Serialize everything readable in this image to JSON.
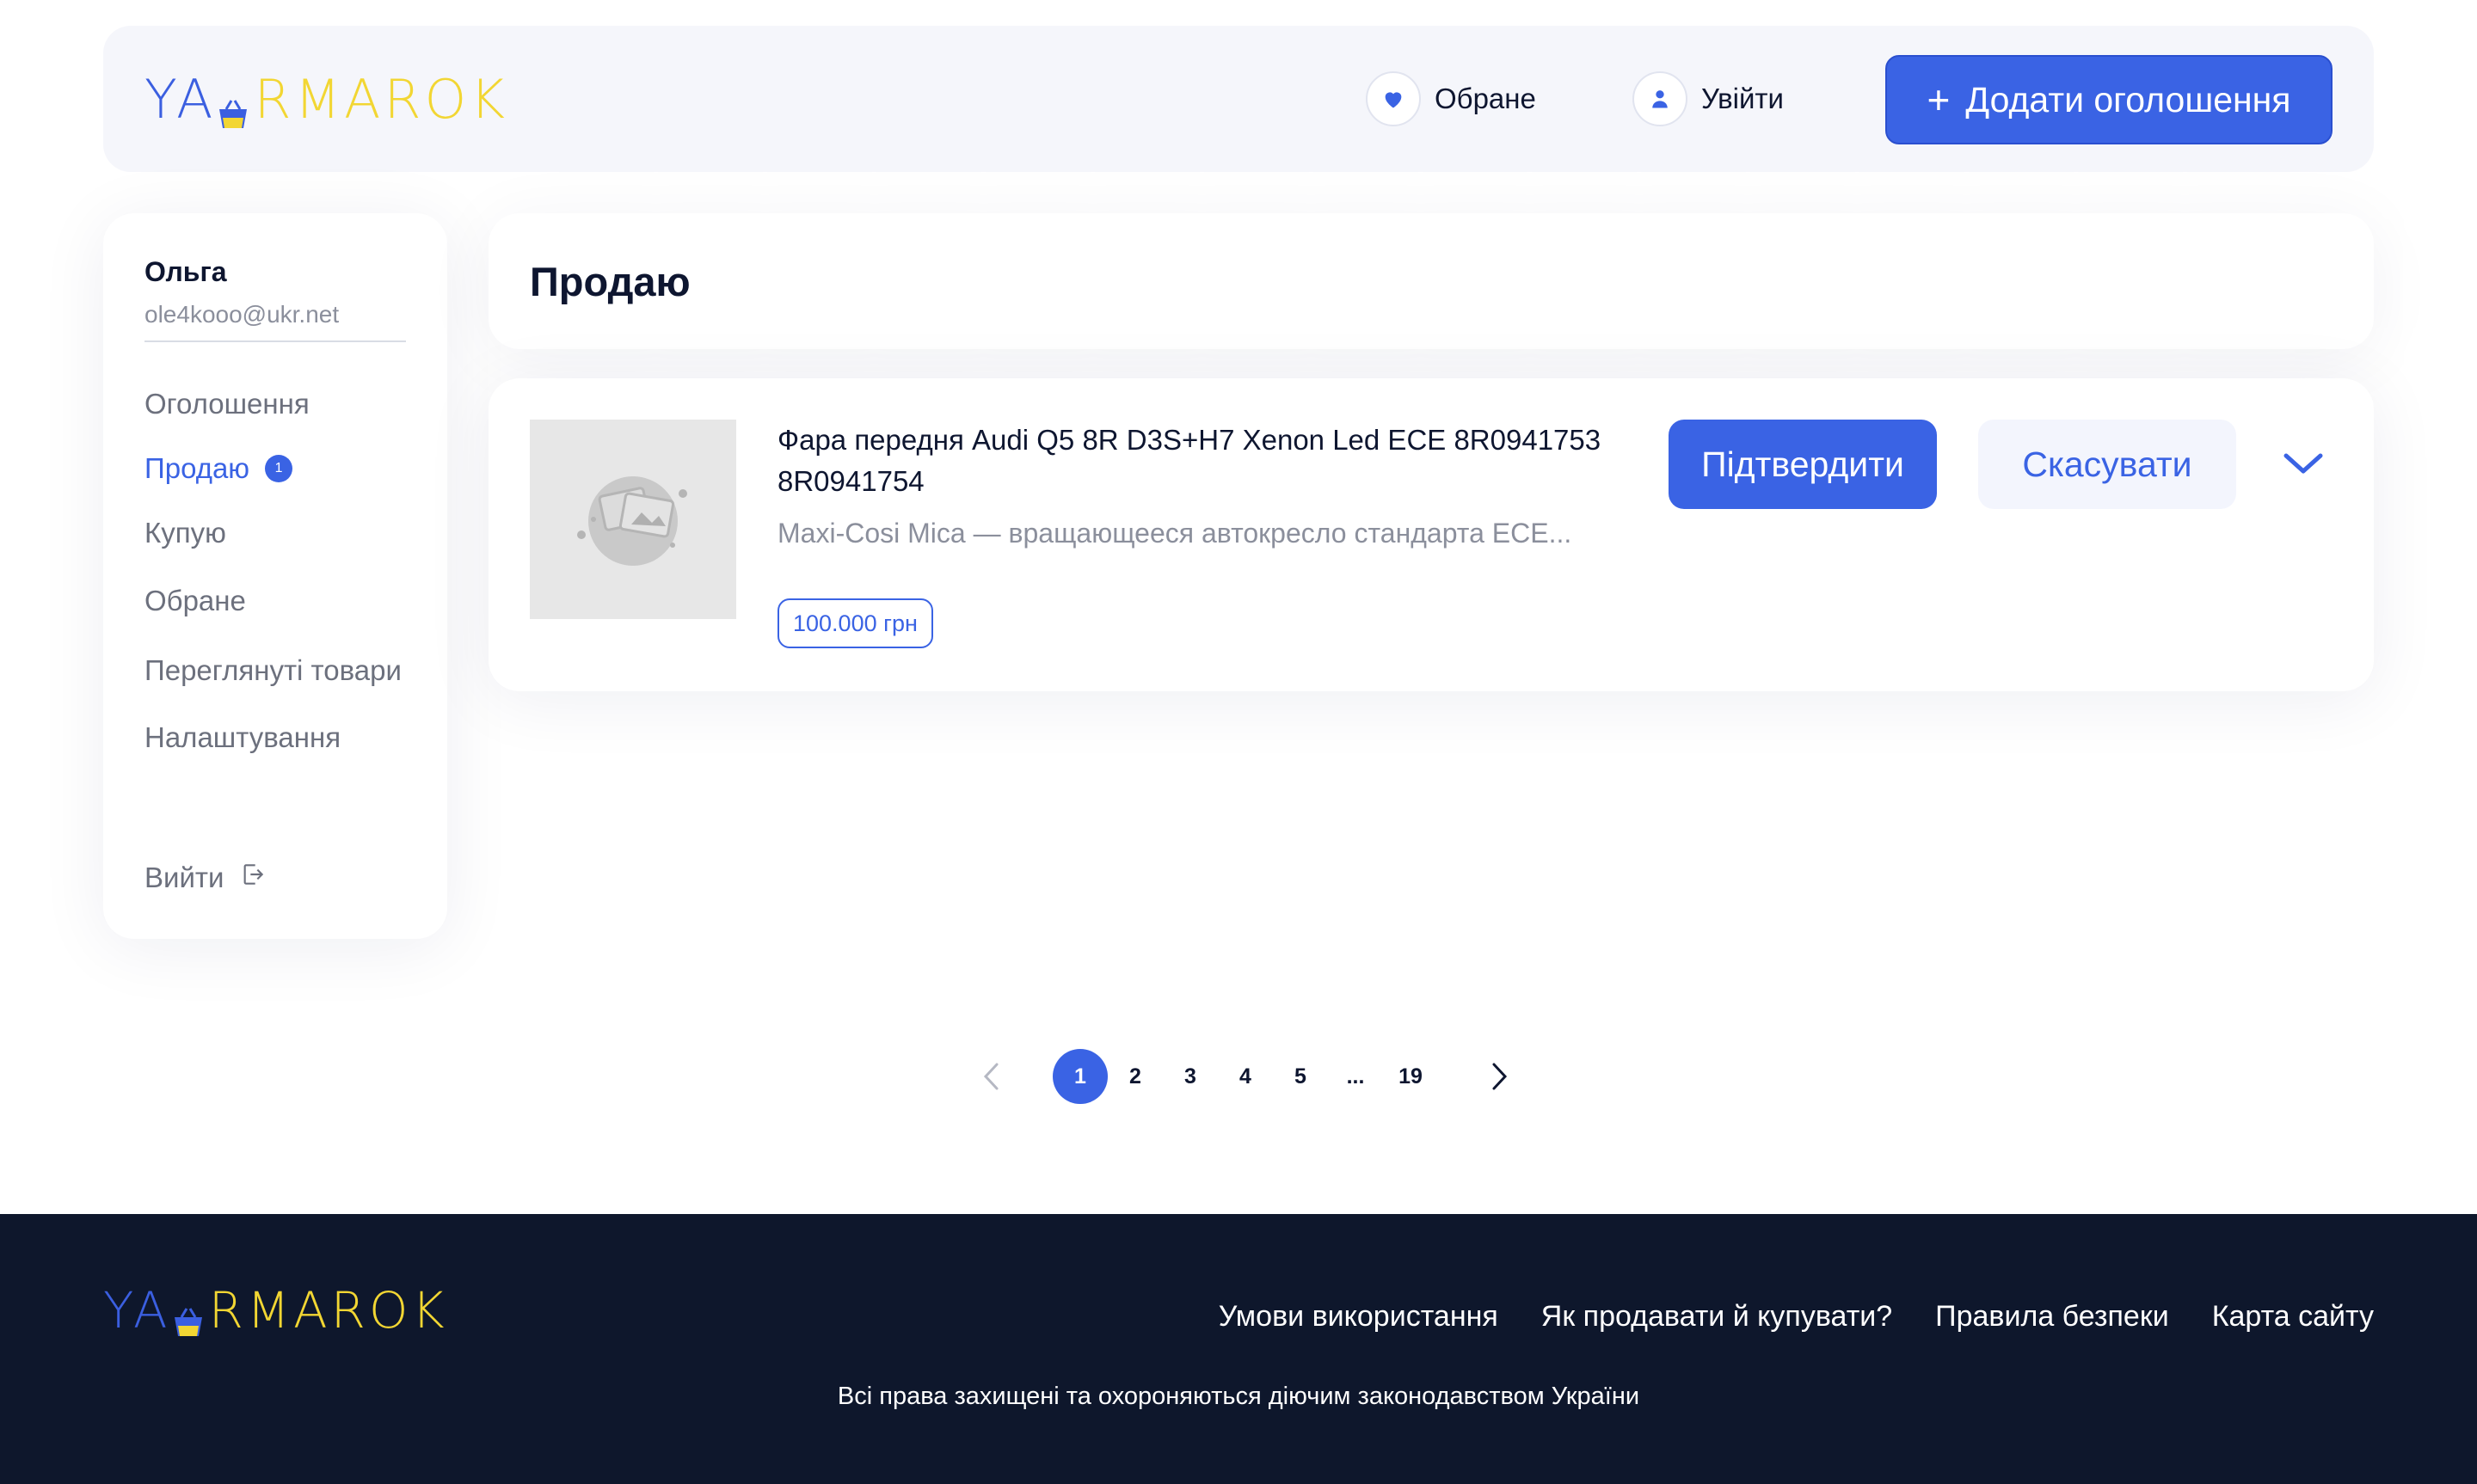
{
  "brand": {
    "logo_text_blue": "YA",
    "logo_text_yellow": "RMAROK",
    "colors": {
      "blue": "#3b5fe0",
      "yellow": "#f2d633",
      "accent": "#3a63e4",
      "footer_bg": "#0e172c"
    }
  },
  "header": {
    "favorites_label": "Обране",
    "favorites_icon": "heart-icon",
    "login_label": "Увійти",
    "login_icon": "user-icon",
    "add_listing_label": "Додати оголошення"
  },
  "sidebar": {
    "user_name": "Ольга",
    "user_email": "ole4kooo@ukr.net",
    "items": [
      {
        "label": "Оголошення",
        "active": false
      },
      {
        "label": "Продаю",
        "active": true,
        "badge": "1"
      },
      {
        "label": "Купую",
        "active": false
      },
      {
        "label": "Обране",
        "active": false
      },
      {
        "label": "Переглянуті товари",
        "active": false
      },
      {
        "label": "Налаштування",
        "active": false
      }
    ],
    "logout_label": "Вийти"
  },
  "main": {
    "page_title": "Продаю",
    "listing": {
      "title": "Фара передня Audi Q5 8R D3S+H7 Xenon Led ECE 8R0941753 8R0941754",
      "description": "Maxi-Cosi Mica — вращающееся автокресло стандарта ECE...",
      "price": "100.000 грн",
      "confirm_label": "Підтвердити",
      "cancel_label": "Скасувати"
    }
  },
  "pagination": {
    "pages": [
      "1",
      "2",
      "3",
      "4",
      "5",
      "...",
      "19"
    ],
    "current": "1"
  },
  "footer": {
    "links": [
      "Умови використання",
      "Як продавати й купувати?",
      "Правила безпеки",
      "Карта сайту"
    ],
    "copyright": "Всі права захищені та охороняються діючим законодавством України"
  }
}
